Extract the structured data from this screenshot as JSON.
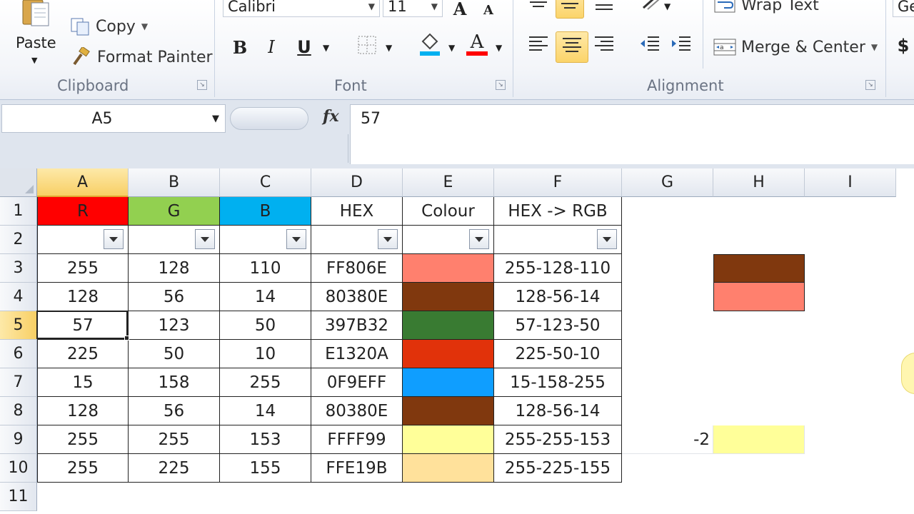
{
  "ribbon": {
    "clipboard": {
      "label": "Clipboard",
      "paste": "Paste",
      "copy": "Copy",
      "format_painter": "Format Painter"
    },
    "font": {
      "label": "Font",
      "font_name": "Calibri",
      "font_size": "11",
      "bold": "B",
      "italic": "I",
      "underline": "U"
    },
    "alignment": {
      "label": "Alignment",
      "wrap_text": "Wrap Text",
      "merge_center": "Merge & Center"
    },
    "number": {
      "format_partial": "Ge",
      "currency": "$"
    }
  },
  "formula_bar": {
    "name_box": "A5",
    "fx": "fx",
    "formula": "57"
  },
  "grid": {
    "columns": [
      "A",
      "B",
      "C",
      "D",
      "E",
      "F",
      "G",
      "H",
      "I"
    ],
    "rows": [
      "1",
      "2",
      "3",
      "4",
      "5",
      "6",
      "7",
      "8",
      "9",
      "10",
      "11"
    ],
    "active_cell": "A5",
    "headers": [
      "R",
      "G",
      "B",
      "HEX",
      "Colour",
      "HEX -> RGB"
    ],
    "header_colors": [
      "#ff0000",
      "#92d050",
      "#00b0f0"
    ],
    "data": [
      {
        "r": "255",
        "g": "128",
        "b": "110",
        "hex": "FF806E",
        "colour": "#ff806e",
        "rgb": "255-128-110"
      },
      {
        "r": "128",
        "g": "56",
        "b": "14",
        "hex": "80380E",
        "colour": "#80380e",
        "rgb": "128-56-14"
      },
      {
        "r": "57",
        "g": "123",
        "b": "50",
        "hex": "397B32",
        "colour": "#397b32",
        "rgb": "57-123-50"
      },
      {
        "r": "225",
        "g": "50",
        "b": "10",
        "hex": "E1320A",
        "colour": "#e1320a",
        "rgb": "225-50-10"
      },
      {
        "r": "15",
        "g": "158",
        "b": "255",
        "hex": "0F9EFF",
        "colour": "#0f9eff",
        "rgb": "15-158-255"
      },
      {
        "r": "128",
        "g": "56",
        "b": "14",
        "hex": "80380E",
        "colour": "#80380e",
        "rgb": "128-56-14"
      },
      {
        "r": "255",
        "g": "255",
        "b": "153",
        "hex": "FFFF99",
        "colour": "#ffff99",
        "rgb": "255-255-153"
      },
      {
        "r": "255",
        "g": "225",
        "b": "155",
        "hex": "FFE19B",
        "colour": "#ffe19b",
        "rgb": "255-225-155"
      }
    ],
    "g9_value": "-2",
    "side_swatches": {
      "h3": "#80380e",
      "h4": "#ff806e",
      "h9": "#ffff99"
    }
  }
}
